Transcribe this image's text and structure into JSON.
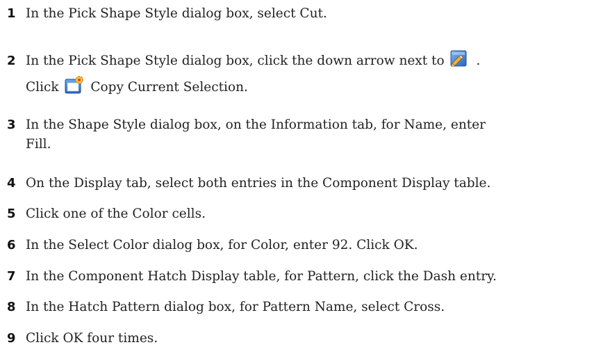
{
  "steps": [
    {
      "num": "1",
      "text": "In the Pick Shape Style dialog box, select Cut."
    },
    {
      "num": "2",
      "line1_before": "In the Pick Shape Style dialog box, click the down arrow next to",
      "line1_after": ".",
      "line2_before": "Click",
      "line2_after": "Copy Current Selection.",
      "edit_icon": "edit-style-icon",
      "copy_icon": "copy-selection-icon"
    },
    {
      "num": "3",
      "line1": "In the Shape Style dialog box, on the Information tab, for Name, enter",
      "line2": "Fill."
    },
    {
      "num": "4",
      "text": "On the Display tab, select both entries in the Component Display table."
    },
    {
      "num": "5",
      "text": "Click one of the Color cells."
    },
    {
      "num": "6",
      "text": "In the Select Color dialog box, for Color, enter 92. Click OK."
    },
    {
      "num": "7",
      "text": "In the Component Hatch Display table, for Pattern, click the Dash entry."
    },
    {
      "num": "8",
      "text": "In the Hatch Pattern dialog box, for Pattern Name, select Cross."
    },
    {
      "num": "9",
      "text": "Click OK four times."
    }
  ]
}
